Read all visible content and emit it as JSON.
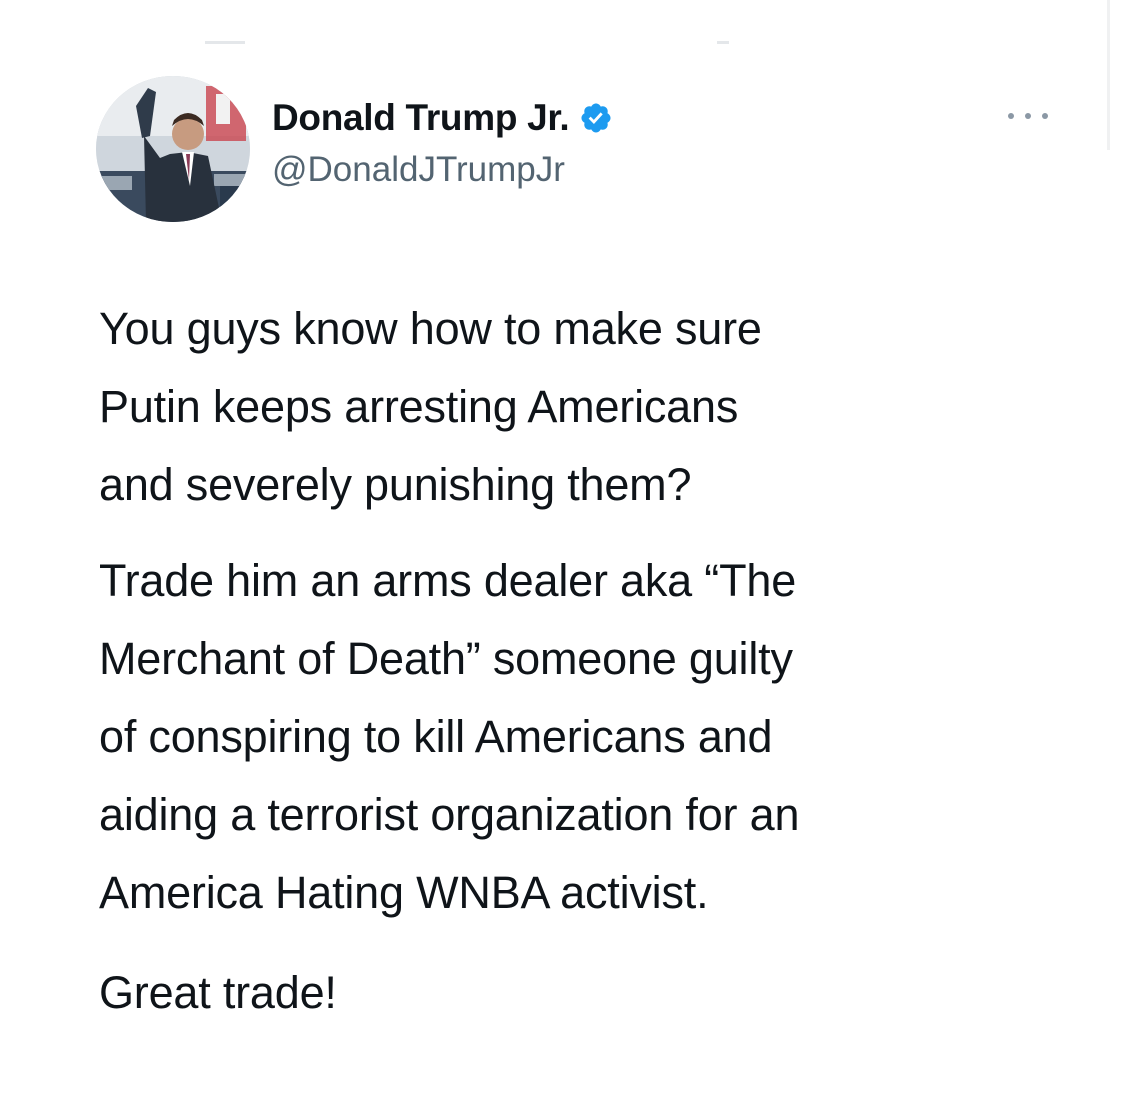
{
  "colors": {
    "text": "#0f1419",
    "secondary": "#536471",
    "verified": "#1d9bf0",
    "background": "#ffffff"
  },
  "author": {
    "name": "Donald Trump Jr.",
    "handle": "@DonaldJTrumpJr",
    "verified": true,
    "avatar_icon": "profile-photo"
  },
  "tweet": {
    "paragraphs": [
      {
        "lines": [
          "You guys know how to make sure",
          "Putin keeps arresting Americans",
          "and severely punishing them?"
        ]
      },
      {
        "lines": [
          "Trade him an arms dealer aka “The",
          "Merchant of Death” someone guilty",
          "of conspiring to kill Americans and",
          "aiding a terrorist organization for an",
          "America Hating WNBA activist."
        ]
      },
      {
        "lines": [
          "Great trade!"
        ]
      }
    ]
  },
  "more_icon": "more-horizontal-icon"
}
